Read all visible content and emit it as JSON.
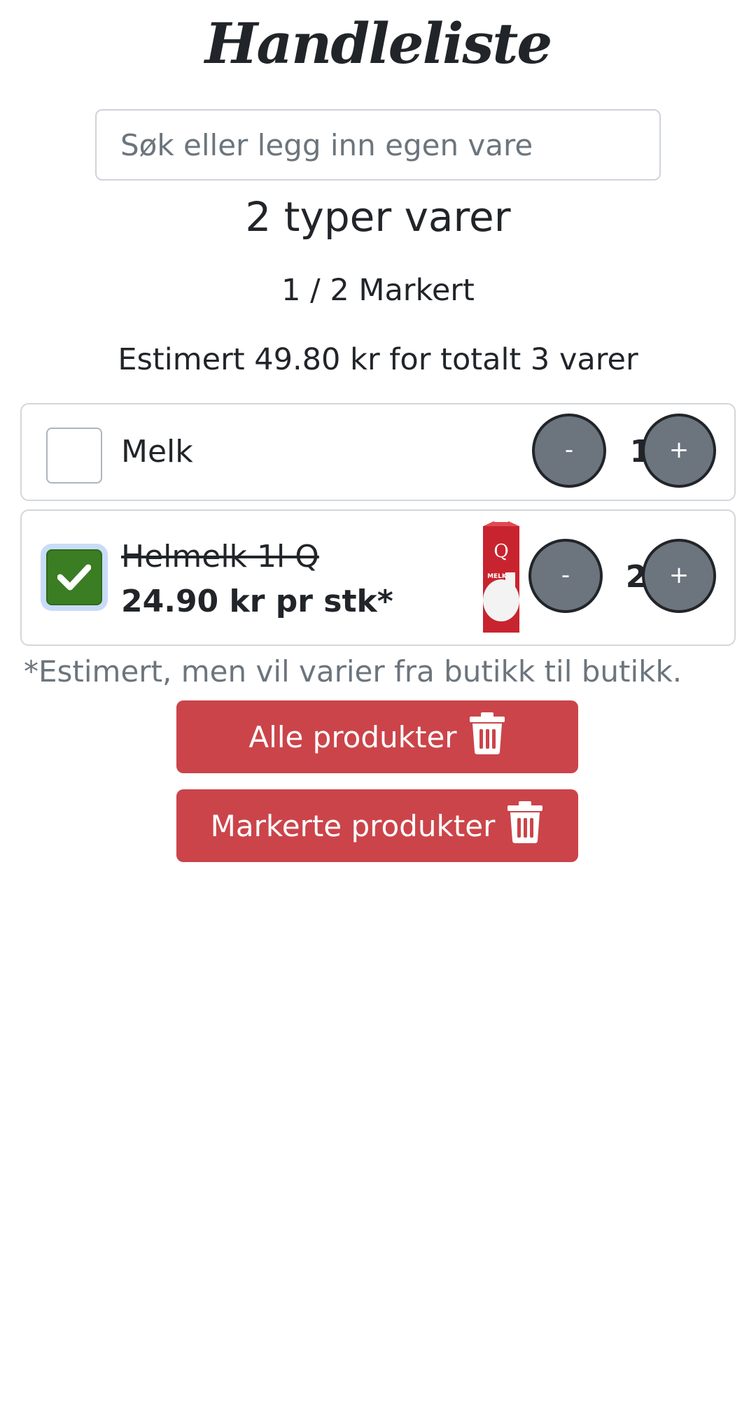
{
  "header": {
    "title": "Handleliste"
  },
  "search": {
    "placeholder": "Søk eller legg inn egen vare"
  },
  "summary": {
    "types": "2 typer varer",
    "marked": "1 / 2 Markert",
    "estimate": "Estimert 49.80 kr for totalt 3 varer"
  },
  "items": [
    {
      "name": "Melk",
      "checked": false,
      "quantity": "1",
      "minus": "-",
      "plus": "+"
    },
    {
      "name": "Helmelk 1l Q",
      "price": "24.90 kr pr stk*",
      "checked": true,
      "quantity": "2",
      "minus": "-",
      "plus": "+",
      "image_text": "Q",
      "image_subtext": "MELK"
    }
  ],
  "note": "*Estimert, men vil varier fra butikk til butikk.",
  "actions": {
    "delete_all_label": "Alle produkter",
    "delete_marked_label": "Markerte produkter"
  },
  "colors": {
    "danger": "#cb444a",
    "checked_green": "#3a7d22",
    "qty_button": "#6c757d"
  }
}
